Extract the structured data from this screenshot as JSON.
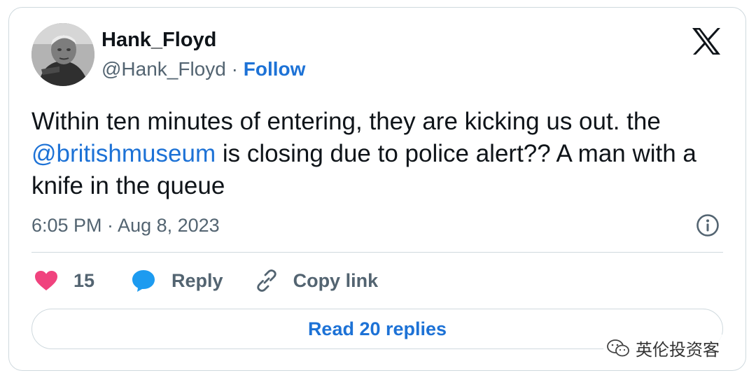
{
  "author": {
    "name": "Hank_Floyd",
    "handle": "@Hank_Floyd",
    "separator": " · ",
    "follow_label": "Follow"
  },
  "tweet": {
    "text_part1": "Within ten minutes of entering, they are kicking us out.  the ",
    "mention": "@britishmuseum",
    "text_part2": " is closing due to police alert?? A man with a knife in the queue",
    "timestamp": "6:05 PM · Aug 8, 2023"
  },
  "actions": {
    "like_count": "15",
    "reply_label": "Reply",
    "copy_link_label": "Copy link"
  },
  "read_replies_label": "Read 20 replies",
  "watermark": "英伦投资客",
  "icons": {
    "platform": "x-logo-icon",
    "info": "info-icon",
    "like": "heart-icon",
    "reply": "speech-bubble-icon",
    "copy": "link-icon",
    "watermark": "wechat-icon"
  },
  "colors": {
    "accent": "#1d72d6",
    "like": "#f0437e",
    "reply": "#1d9bf0",
    "muted": "#536471",
    "text": "#0f1419",
    "border": "#cfd9de"
  }
}
